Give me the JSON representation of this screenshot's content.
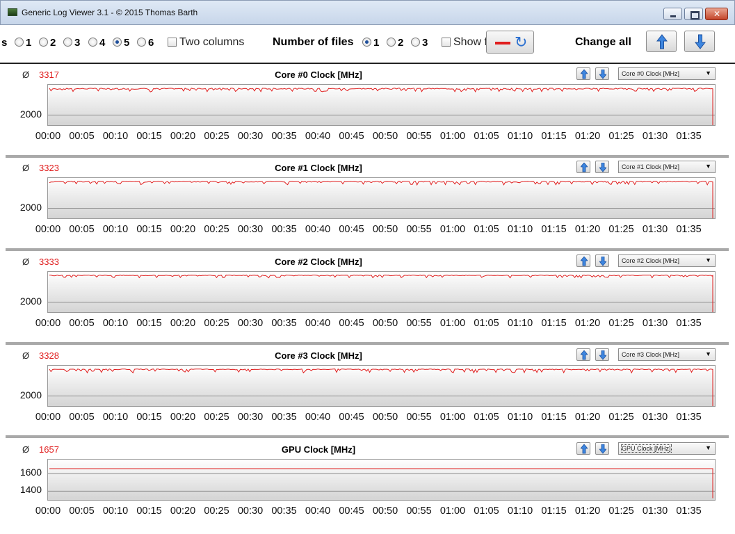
{
  "window": {
    "title": "Generic Log Viewer 3.1 - © 2015 Thomas Barth",
    "icon": "app-icon",
    "controls": [
      "minimize",
      "maximize",
      "close"
    ]
  },
  "toolbar": {
    "panel_count_prefix": "s",
    "panel_count_options": [
      "1",
      "2",
      "3",
      "4",
      "5",
      "6"
    ],
    "panel_count_selected": "5",
    "two_columns_label": "Two columns",
    "two_columns_checked": false,
    "number_of_files_label": "Number of files",
    "number_of_files_options": [
      "1",
      "2",
      "3"
    ],
    "number_of_files_selected": "1",
    "show_label": "Show f",
    "show_checked": false,
    "change_all_label": "Change all",
    "accent_line_color": "#e01e1e",
    "icons": [
      "red-line-icon",
      "refresh-icon",
      "arrow-up-icon",
      "arrow-down-icon"
    ]
  },
  "x_tick_labels": [
    "00:00",
    "00:05",
    "00:10",
    "00:15",
    "00:20",
    "00:25",
    "00:30",
    "00:35",
    "00:40",
    "00:45",
    "00:50",
    "00:55",
    "01:00",
    "01:05",
    "01:10",
    "01:15",
    "01:20",
    "01:25",
    "01:30",
    "01:35"
  ],
  "panels": [
    {
      "avg_symbol": "Ø",
      "avg_value": "3317",
      "title": "Core #0 Clock [MHz]",
      "select_value": "Core #0 Clock [MHz]"
    },
    {
      "avg_symbol": "Ø",
      "avg_value": "3323",
      "title": "Core #1 Clock [MHz]",
      "select_value": "Core #1 Clock [MHz]"
    },
    {
      "avg_symbol": "Ø",
      "avg_value": "3333",
      "title": "Core #2 Clock [MHz]",
      "select_value": "Core #2 Clock [MHz]"
    },
    {
      "avg_symbol": "Ø",
      "avg_value": "3328",
      "title": "Core #3 Clock [MHz]",
      "select_value": "Core #3 Clock [MHz]"
    },
    {
      "avg_symbol": "Ø",
      "avg_value": "1657",
      "title": "GPU Clock [MHz]",
      "select_value": "GPU Clock [MHz]"
    }
  ],
  "chart_data": [
    {
      "type": "line",
      "title": "Core #0 Clock [MHz]",
      "x_range": [
        "00:00",
        "01:39"
      ],
      "ylim": [
        1500,
        3500
      ],
      "y_ticks": [
        2000
      ],
      "series": [
        {
          "values": {
            "typical": 3300,
            "min": 3150,
            "max": 3350,
            "end_drop": 1500
          },
          "color": "#e01e1e"
        }
      ]
    },
    {
      "type": "line",
      "title": "Core #1 Clock [MHz]",
      "x_range": [
        "00:00",
        "01:39"
      ],
      "ylim": [
        1500,
        3500
      ],
      "y_ticks": [
        2000
      ],
      "series": [
        {
          "values": {
            "typical": 3310,
            "min": 3150,
            "max": 3350,
            "end_drop": 1500
          },
          "color": "#e01e1e"
        }
      ]
    },
    {
      "type": "line",
      "title": "Core #2 Clock [MHz]",
      "x_range": [
        "00:00",
        "01:39"
      ],
      "ylim": [
        1500,
        3500
      ],
      "y_ticks": [
        2000
      ],
      "series": [
        {
          "values": {
            "typical": 3320,
            "min": 3200,
            "max": 3350,
            "end_drop": 1500
          },
          "color": "#e01e1e"
        }
      ]
    },
    {
      "type": "line",
      "title": "Core #3 Clock [MHz]",
      "x_range": [
        "00:00",
        "01:39"
      ],
      "ylim": [
        1500,
        3500
      ],
      "y_ticks": [
        2000
      ],
      "series": [
        {
          "values": {
            "typical": 3315,
            "min": 3150,
            "max": 3350,
            "end_drop": 1500
          },
          "color": "#e01e1e"
        }
      ]
    },
    {
      "type": "line",
      "title": "GPU Clock [MHz]",
      "x_range": [
        "00:00",
        "01:39"
      ],
      "ylim": [
        1300,
        1760
      ],
      "y_ticks": [
        1400,
        1600
      ],
      "series": [
        {
          "values": {
            "typical": 1657,
            "min": 1657,
            "max": 1657,
            "end_drop": 1320
          },
          "color": "#e01e1e"
        }
      ]
    }
  ]
}
